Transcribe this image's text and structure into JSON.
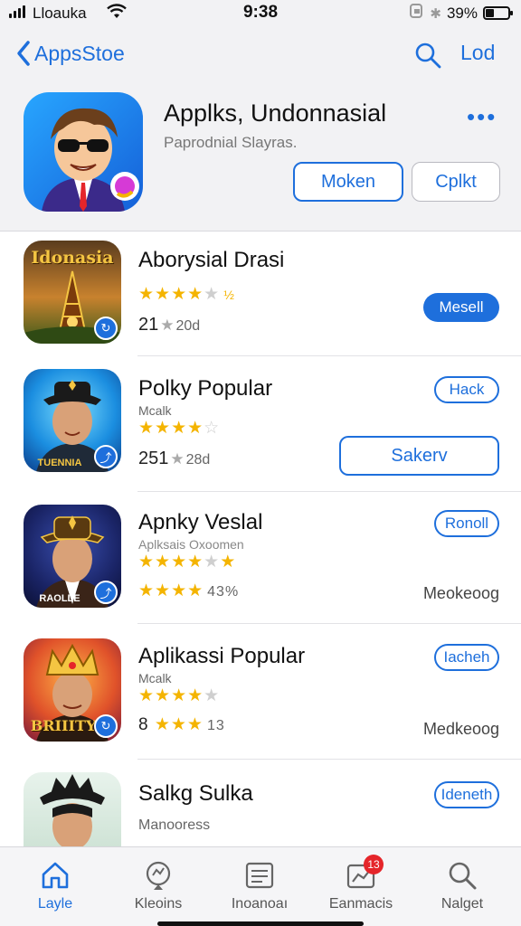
{
  "status_bar": {
    "carrier": "Lloauka",
    "time": "9:38",
    "battery_percent": "39%",
    "battery_level": 0.39
  },
  "header": {
    "back_label": "AppsStoe",
    "edit_label": "Lod",
    "app_title": "Applks, Undonnasial",
    "app_subtitle": "Paprodnial Slayras.",
    "primary_button": "Moken",
    "secondary_button": "Cplkt"
  },
  "list": [
    {
      "title": "Aborysial Drasi",
      "subtitle": "",
      "thumb_text": "Idonasia",
      "stars_tail": "½",
      "count_main": "21",
      "count_sub": "20d",
      "action": "Mesell"
    },
    {
      "title": "Polky Popular",
      "subtitle": "Mcalk",
      "thumb_text": "TUENNIA",
      "pill": "Hack",
      "count_main": "251",
      "count_sub": "28d",
      "action": "Sakerv"
    },
    {
      "title": "Apnky Veslal",
      "subtitle": "Aplksais Oxoomen",
      "thumb_text": "RAOLLE",
      "pill": "Ronoll",
      "stars_line2_tail": "43%",
      "right_text": "Meokeoog"
    },
    {
      "title": "Aplikassi Popular",
      "subtitle": "Mcalk",
      "thumb_text": "BRIIITY",
      "pill": "Iacheh",
      "count_prefix": "8",
      "count_tail": "13",
      "right_text": "Medkeoog"
    },
    {
      "title": "Salkg Sulka",
      "subtitle": "Manooress",
      "pill": "Ideneth"
    }
  ],
  "tabs": [
    {
      "label": "Layle",
      "icon": "home-icon"
    },
    {
      "label": "Kleoins",
      "icon": "location-icon"
    },
    {
      "label": "Inoanoaı",
      "icon": "news-icon"
    },
    {
      "label": "Eanmacis",
      "icon": "chart-icon",
      "badge": "13"
    },
    {
      "label": "Nalget",
      "icon": "search-icon"
    }
  ],
  "colors": {
    "accent": "#1e6fdc",
    "star": "#f4b400",
    "badge": "#e5252a"
  }
}
